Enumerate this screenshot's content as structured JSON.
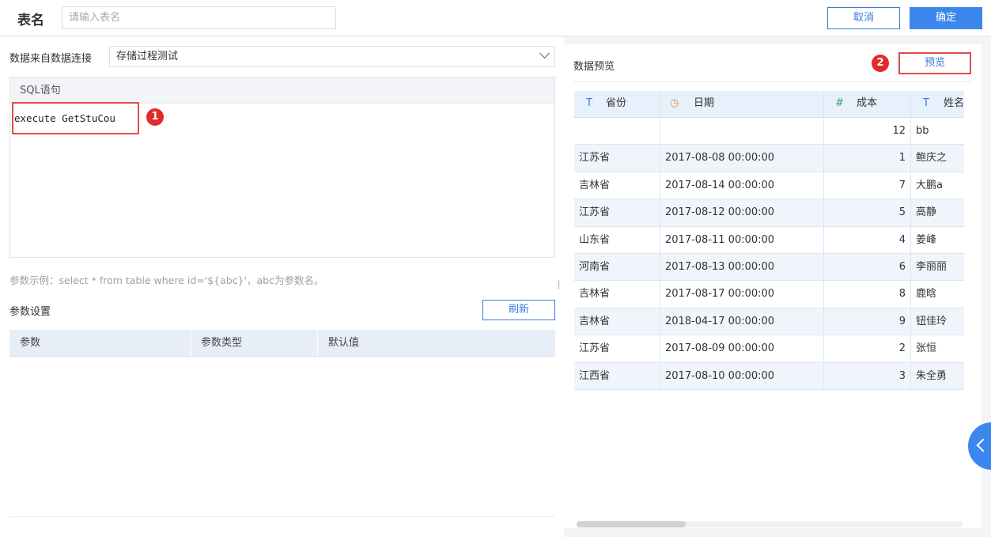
{
  "header": {
    "title": "表名",
    "name_placeholder": "请输入表名",
    "cancel_label": "取消",
    "ok_label": "确定"
  },
  "source": {
    "label": "数据来自数据连接",
    "selected": "存储过程测试"
  },
  "sql": {
    "heading": "SQL语句",
    "code": "execute GetStuCou",
    "badge": "1"
  },
  "hint": "参数示例：select * from table where id='${abc}'，abc为参数名。",
  "params": {
    "label": "参数设置",
    "refresh_label": "刷新",
    "columns": [
      "参数",
      "参数类型",
      "默认值"
    ]
  },
  "preview": {
    "label": "数据预览",
    "button_label": "预览",
    "badge": "2",
    "columns": [
      {
        "type_icon": "text-type-icon",
        "glyph": "T",
        "name": "省份"
      },
      {
        "type_icon": "date-type-icon",
        "glyph": "◷",
        "name": "日期"
      },
      {
        "type_icon": "number-type-icon",
        "glyph": "#",
        "name": "成本"
      },
      {
        "type_icon": "text-type-icon",
        "glyph": "T",
        "name": "姓名"
      }
    ],
    "rows": [
      [
        "",
        "",
        "12",
        "bb"
      ],
      [
        "江苏省",
        "2017-08-08 00:00:00",
        "1",
        "鲍庆之"
      ],
      [
        "吉林省",
        "2017-08-14 00:00:00",
        "7",
        "大鹏a"
      ],
      [
        "江苏省",
        "2017-08-12 00:00:00",
        "5",
        "高静"
      ],
      [
        "山东省",
        "2017-08-11 00:00:00",
        "4",
        "姜峰"
      ],
      [
        "河南省",
        "2017-08-13 00:00:00",
        "6",
        "李丽丽"
      ],
      [
        "吉林省",
        "2017-08-17 00:00:00",
        "8",
        "鹿晗"
      ],
      [
        "吉林省",
        "2018-04-17 00:00:00",
        "9",
        "钮佳玲"
      ],
      [
        "江苏省",
        "2017-08-09 00:00:00",
        "2",
        "张恒"
      ],
      [
        "江西省",
        "2017-08-10 00:00:00",
        "3",
        "朱全勇"
      ]
    ]
  },
  "colors": {
    "accent": "#3c87ef",
    "highlight_border": "#e34a4a",
    "badge": "#e12a2a",
    "date_icon": "#f0883e",
    "number_icon": "#35a56b",
    "text_icon": "#3c78d8"
  }
}
